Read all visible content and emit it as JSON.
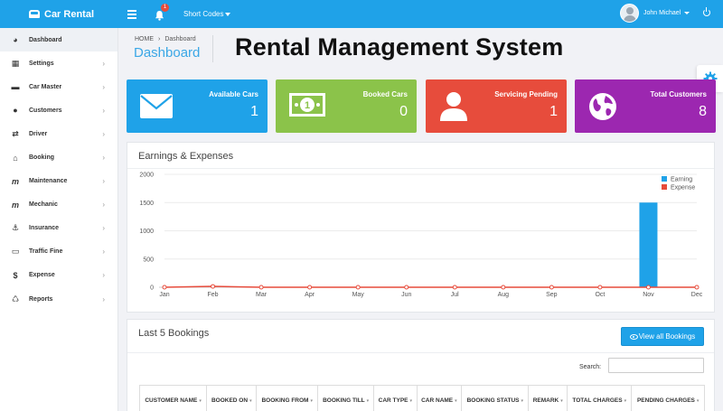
{
  "topbar": {
    "brand": "Car Rental",
    "notification_count": "1",
    "shortcodes_label": "Short Codes",
    "user_name": "John Michael"
  },
  "sidebar": {
    "items": [
      {
        "label": "Dashboard",
        "icon": "dashboard-icon"
      },
      {
        "label": "Settings",
        "icon": "table-icon"
      },
      {
        "label": "Car Master",
        "icon": "car-icon"
      },
      {
        "label": "Customers",
        "icon": "users-icon"
      },
      {
        "label": "Driver",
        "icon": "exchange-icon"
      },
      {
        "label": "Booking",
        "icon": "bank-icon"
      },
      {
        "label": "Maintenance",
        "icon": "m-icon"
      },
      {
        "label": "Mechanic",
        "icon": "m-icon"
      },
      {
        "label": "Insurance",
        "icon": "anchor-icon"
      },
      {
        "label": "Traffic Fine",
        "icon": "credit-card-icon"
      },
      {
        "label": "Expense",
        "icon": "dollar-icon"
      },
      {
        "label": "Reports",
        "icon": "recycle-icon"
      }
    ]
  },
  "breadcrumb": {
    "home": "HOME",
    "current": "Dashboard"
  },
  "page_title": "Dashboard",
  "headline": "Rental Management System",
  "stats": [
    {
      "label": "Available Cars",
      "value": "1",
      "color": "#1fa2e8",
      "icon": "envelope-icon"
    },
    {
      "label": "Booked Cars",
      "value": "0",
      "color": "#8bc34a",
      "icon": "money-icon"
    },
    {
      "label": "Servicing Pending",
      "value": "1",
      "color": "#e74c3c",
      "icon": "user-icon"
    },
    {
      "label": "Total Customers",
      "value": "8",
      "color": "#9c27b0",
      "icon": "globe-icon"
    }
  ],
  "chart_panel": {
    "title": "Earnings & Expenses"
  },
  "chart_data": {
    "type": "bar",
    "categories": [
      "Jan",
      "Feb",
      "Mar",
      "Apr",
      "May",
      "Jun",
      "Jul",
      "Aug",
      "Sep",
      "Oct",
      "Nov",
      "Dec"
    ],
    "series": [
      {
        "name": "Earning",
        "type": "bar",
        "color": "#1fa2e8",
        "values": [
          0,
          0,
          0,
          0,
          0,
          0,
          0,
          0,
          0,
          0,
          1500,
          0
        ]
      },
      {
        "name": "Expense",
        "type": "line",
        "color": "#e74c3c",
        "values": [
          0,
          15,
          0,
          0,
          0,
          0,
          0,
          0,
          0,
          0,
          0,
          0
        ]
      }
    ],
    "yticks": [
      0,
      500,
      1000,
      1500,
      2000
    ],
    "ylim": [
      0,
      2000
    ],
    "legend": "top-right"
  },
  "bookings": {
    "title": "Last 5 Bookings",
    "view_all_label": "View all Bookings",
    "search_label": "Search:",
    "search_value": "",
    "columns": [
      "CUSTOMER NAME",
      "BOOKED ON",
      "BOOKING FROM",
      "BOOKING TILL",
      "CAR TYPE",
      "CAR NAME",
      "BOOKING STATUS",
      "REMARK",
      "TOTAL CHARGES",
      "PENDING CHARGES"
    ]
  }
}
